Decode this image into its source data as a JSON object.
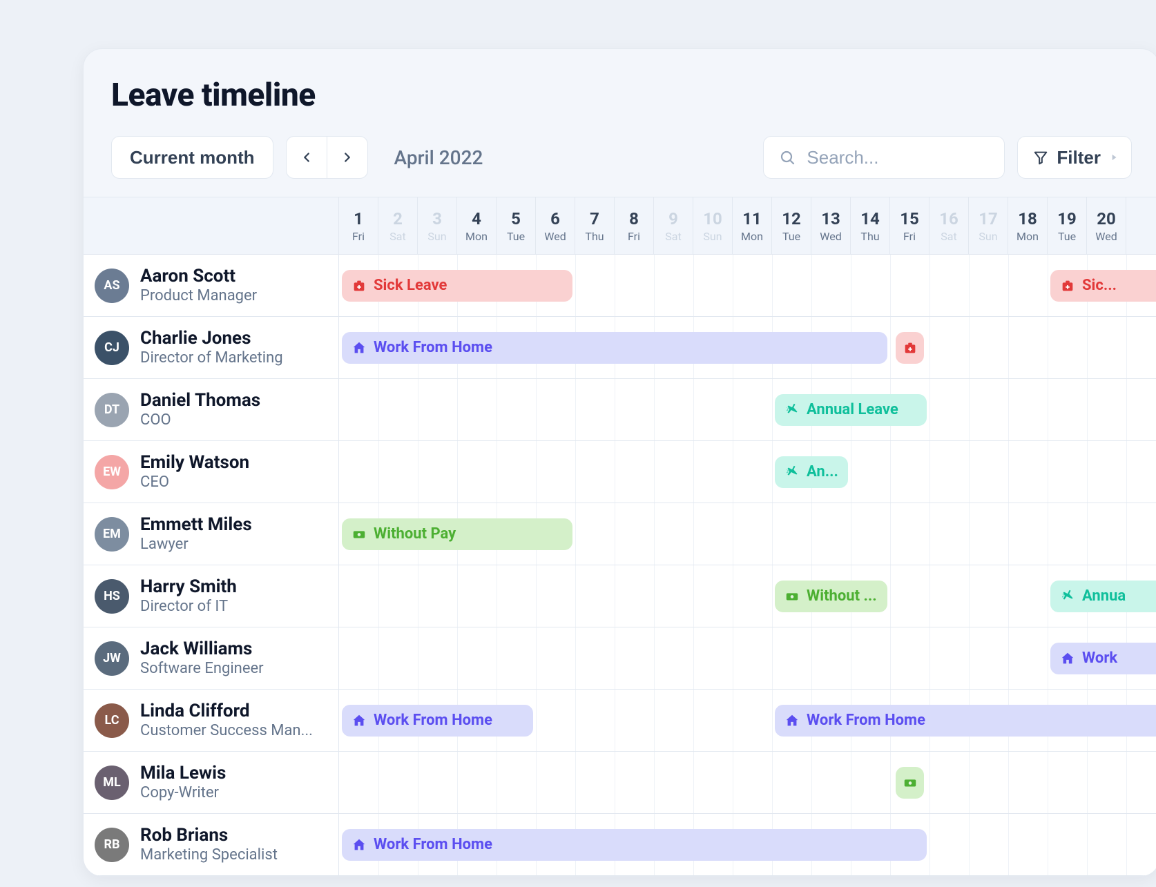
{
  "title": "Leave timeline",
  "controls": {
    "current_month": "Current month",
    "month_label": "April 2022",
    "search_placeholder": "Search...",
    "filter": "Filter"
  },
  "days": [
    {
      "n": "1",
      "d": "Fri",
      "muted": false
    },
    {
      "n": "2",
      "d": "Sat",
      "muted": true
    },
    {
      "n": "3",
      "d": "Sun",
      "muted": true
    },
    {
      "n": "4",
      "d": "Mon",
      "muted": false
    },
    {
      "n": "5",
      "d": "Tue",
      "muted": false
    },
    {
      "n": "6",
      "d": "Wed",
      "muted": false
    },
    {
      "n": "7",
      "d": "Thu",
      "muted": false
    },
    {
      "n": "8",
      "d": "Fri",
      "muted": false
    },
    {
      "n": "9",
      "d": "Sat",
      "muted": true
    },
    {
      "n": "10",
      "d": "Sun",
      "muted": true
    },
    {
      "n": "11",
      "d": "Mon",
      "muted": false
    },
    {
      "n": "12",
      "d": "Tue",
      "muted": false
    },
    {
      "n": "13",
      "d": "Wed",
      "muted": false
    },
    {
      "n": "14",
      "d": "Thu",
      "muted": false
    },
    {
      "n": "15",
      "d": "Fri",
      "muted": false
    },
    {
      "n": "16",
      "d": "Sat",
      "muted": true
    },
    {
      "n": "17",
      "d": "Sun",
      "muted": true
    },
    {
      "n": "18",
      "d": "Mon",
      "muted": false
    },
    {
      "n": "19",
      "d": "Tue",
      "muted": false
    },
    {
      "n": "20",
      "d": "Wed",
      "muted": false
    }
  ],
  "leave_types": {
    "sick": {
      "label": "Sick Leave",
      "short": "Sic...",
      "icon": "medkit",
      "cls": "sick"
    },
    "wfh": {
      "label": "Work From Home",
      "short": "Work",
      "icon": "home",
      "cls": "wfh"
    },
    "annual": {
      "label": "Annual Leave",
      "short": "An...",
      "short2": "Annua",
      "icon": "plane",
      "cls": "annual"
    },
    "nopay": {
      "label": "Without Pay",
      "short": "Without ...",
      "icon": "cash",
      "cls": "nopay"
    }
  },
  "rows": [
    {
      "name": "Aaron Scott",
      "role": "Product Manager",
      "avatar": "#6b7c93",
      "bars": [
        {
          "type": "sick",
          "start": 1,
          "end": 6,
          "label": "Sick Leave"
        },
        {
          "type": "sick",
          "start": 19,
          "end": 20,
          "label": "Sic...",
          "cutRight": true
        }
      ]
    },
    {
      "name": "Charlie Jones",
      "role": "Director of Marketing",
      "avatar": "#3b5168",
      "bars": [
        {
          "type": "wfh",
          "start": 1,
          "end": 14,
          "label": "Work From Home"
        },
        {
          "type": "sick",
          "start": 15,
          "end": 15,
          "label": "",
          "iconOnly": true
        }
      ]
    },
    {
      "name": "Daniel Thomas",
      "role": "COO",
      "avatar": "#9aa4b1",
      "bars": [
        {
          "type": "annual",
          "start": 12,
          "end": 15,
          "label": "Annual Leave"
        }
      ]
    },
    {
      "name": "Emily Watson",
      "role": "CEO",
      "avatar": "#f4a6a6",
      "bars": [
        {
          "type": "annual",
          "start": 12,
          "end": 13,
          "label": "An..."
        }
      ]
    },
    {
      "name": "Emmett Miles",
      "role": "Lawyer",
      "avatar": "#7d8da0",
      "bars": [
        {
          "type": "nopay",
          "start": 1,
          "end": 6,
          "label": "Without Pay"
        }
      ]
    },
    {
      "name": "Harry Smith",
      "role": "Director of IT",
      "avatar": "#4a5a6d",
      "bars": [
        {
          "type": "nopay",
          "start": 12,
          "end": 14,
          "label": "Without ..."
        },
        {
          "type": "annual",
          "start": 19,
          "end": 20,
          "label": "Annua",
          "cutRight": true
        }
      ]
    },
    {
      "name": "Jack Williams",
      "role": "Software Engineer",
      "avatar": "#5a6b7d",
      "bars": [
        {
          "type": "wfh",
          "start": 19,
          "end": 20,
          "label": "Work",
          "cutRight": true
        }
      ]
    },
    {
      "name": "Linda Clifford",
      "role": "Customer Success Man...",
      "avatar": "#8a5a4a",
      "bars": [
        {
          "type": "wfh",
          "start": 1,
          "end": 5,
          "label": "Work From Home"
        },
        {
          "type": "wfh",
          "start": 12,
          "end": 20,
          "label": "Work From Home",
          "cutRight": true
        }
      ]
    },
    {
      "name": "Mila Lewis",
      "role": "Copy-Writer",
      "avatar": "#6a6070",
      "bars": [
        {
          "type": "nopay",
          "start": 15,
          "end": 15,
          "label": "",
          "iconOnly": true
        }
      ]
    },
    {
      "name": "Rob Brians",
      "role": "Marketing Specialist",
      "avatar": "#7a7a7a",
      "bars": [
        {
          "type": "wfh",
          "start": 1,
          "end": 15,
          "label": "Work From Home"
        }
      ]
    }
  ]
}
